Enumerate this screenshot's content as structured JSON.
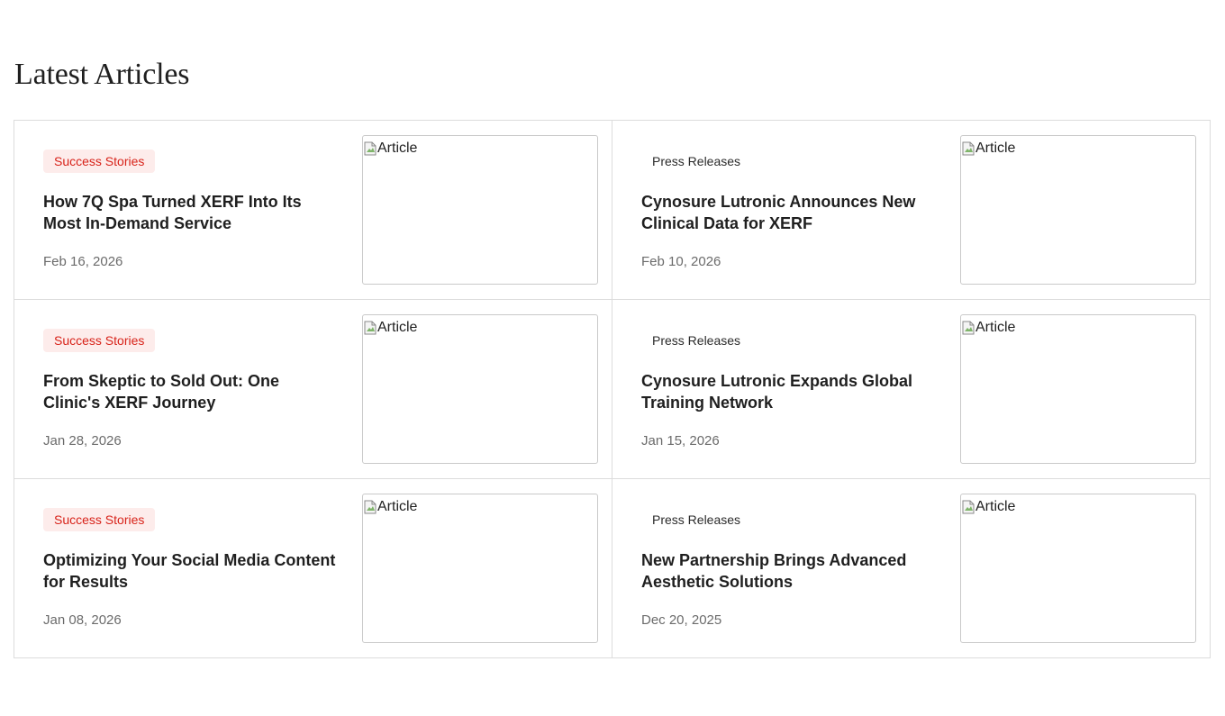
{
  "section": {
    "title": "Latest Articles"
  },
  "articles": [
    {
      "category": "Success Stories",
      "category_style": "success",
      "title": "How 7Q Spa Turned XERF Into Its Most In-Demand Service",
      "date": "Feb 16, 2026",
      "image_alt": "Article"
    },
    {
      "category": "Press Releases",
      "category_style": "press",
      "title": "Cynosure Lutronic Announces New Clinical Data for XERF",
      "date": "Feb 10, 2026",
      "image_alt": "Article"
    },
    {
      "category": "Success Stories",
      "category_style": "success",
      "title": "From Skeptic to Sold Out: One Clinic's XERF Journey",
      "date": "Jan 28, 2026",
      "image_alt": "Article"
    },
    {
      "category": "Press Releases",
      "category_style": "press",
      "title": "Cynosure Lutronic Expands Global Training Network",
      "date": "Jan 15, 2026",
      "image_alt": "Article"
    },
    {
      "category": "Success Stories",
      "category_style": "success",
      "title": "Optimizing Your Social Media Content for Results",
      "date": "Jan 08, 2026",
      "image_alt": "Article"
    },
    {
      "category": "Press Releases",
      "category_style": "press",
      "title": "New Partnership Brings Advanced Aesthetic Solutions",
      "date": "Dec 20, 2025",
      "image_alt": "Article"
    }
  ],
  "colors": {
    "success_tag_bg": "#fdeceb",
    "success_tag_text": "#d8231a",
    "border": "#dcdcdc",
    "date_text": "#6b6b6b"
  },
  "icons": {
    "thumbnail_placeholder": "broken-image-icon"
  }
}
